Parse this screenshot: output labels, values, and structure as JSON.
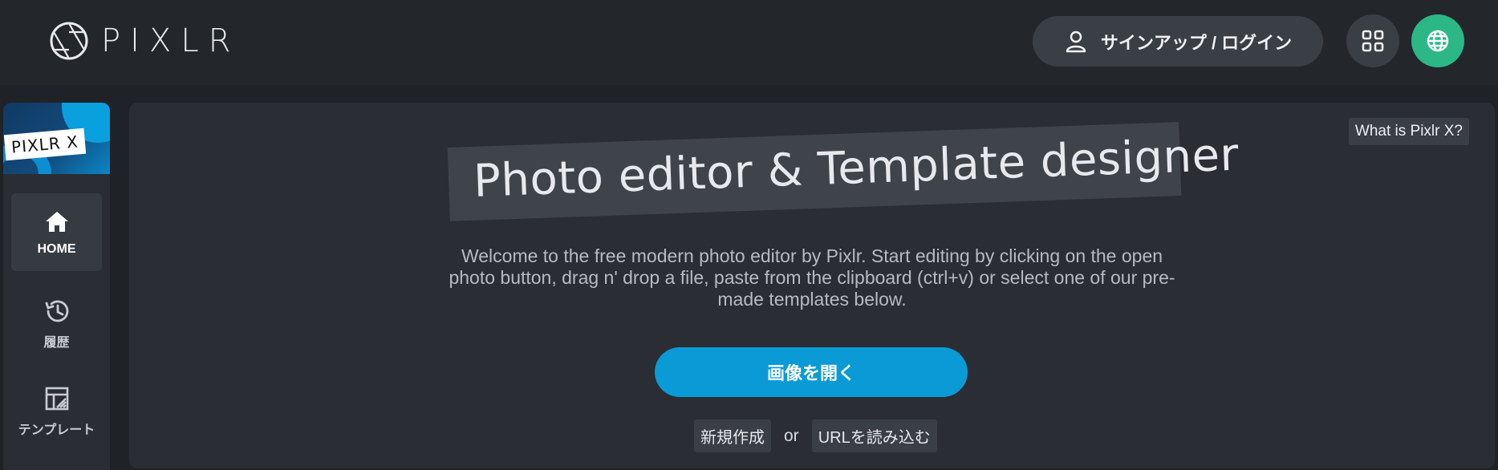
{
  "header": {
    "brand": "PIXLR",
    "signin_label": "サインアップ / ログイン",
    "icons": {
      "logo": "aperture-logo-icon",
      "user": "user-icon",
      "apps": "apps-grid-icon",
      "language": "globe-icon"
    },
    "colors": {
      "language_button": "#2bb886"
    }
  },
  "sidebar": {
    "promo_label": "PIXLR X",
    "items": [
      {
        "label": "HOME",
        "icon": "home-icon",
        "active": true
      },
      {
        "label": "履歴",
        "icon": "history-icon",
        "active": false
      },
      {
        "label": "テンプレート",
        "icon": "template-icon",
        "active": false
      }
    ]
  },
  "main": {
    "what_is_label": "What is Pixlr X?",
    "title": "Photo editor & Template designer",
    "welcome_text": "Welcome to the free modern photo editor by Pixlr. Start editing by clicking on the open photo button, drag n' drop a file, paste from the clipboard (ctrl+v) or select one of our pre-made templates below.",
    "open_button_label": "画像を開く",
    "new_label": "新規作成",
    "or_label": "or",
    "load_url_label": "URLを読み込む",
    "colors": {
      "primary_button": "#0a9bd6"
    }
  }
}
